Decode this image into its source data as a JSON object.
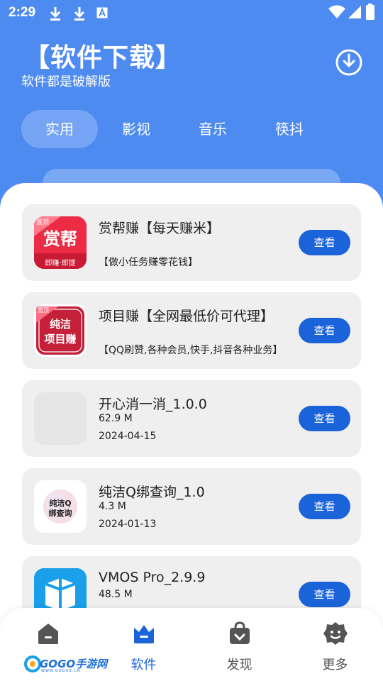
{
  "status": {
    "time": "2:29"
  },
  "header": {
    "title": "【软件下载】",
    "subtitle": "软件都是破解版"
  },
  "tabs": [
    {
      "label": "实用"
    },
    {
      "label": "影视"
    },
    {
      "label": "音乐"
    },
    {
      "label": "筷抖"
    }
  ],
  "cards": [
    {
      "title": "赏帮赚【每天赚米】",
      "desc": "【做小任务赚零花钱】",
      "button": "查看",
      "icon_text": "赏帮",
      "icon_sub": "即赚·即提",
      "corner": "置顶"
    },
    {
      "title": "项目赚【全网最低价可代理】",
      "desc": "【QQ刷赞,各种会员,快手,抖音各种业务】",
      "button": "查看",
      "icon_text_1": "纯洁",
      "icon_text_2": "项目赚",
      "corner": "置顶"
    },
    {
      "title": "开心消一消_1.0.0",
      "size": "62.9 M",
      "date": "2024-04-15",
      "button": "查看"
    },
    {
      "title": "纯洁Q绑查询_1.0",
      "size": "4.3 M",
      "date": "2024-01-13",
      "button": "查看",
      "icon_text_1": "纯洁Q",
      "icon_text_2": "绑查询"
    },
    {
      "title": "VMOS Pro_2.9.9",
      "size": "48.5 M",
      "button": "查看"
    }
  ],
  "nav": [
    {
      "label": ""
    },
    {
      "label": "软件"
    },
    {
      "label": "发现"
    },
    {
      "label": "更多"
    }
  ],
  "watermark": {
    "text": "GOGO手游网",
    "sub": "WWW.GOGO8.CN"
  },
  "colors": {
    "accent": "#1a63d8",
    "header_bg": "#4e8bf0",
    "card_bg": "#efefef"
  }
}
